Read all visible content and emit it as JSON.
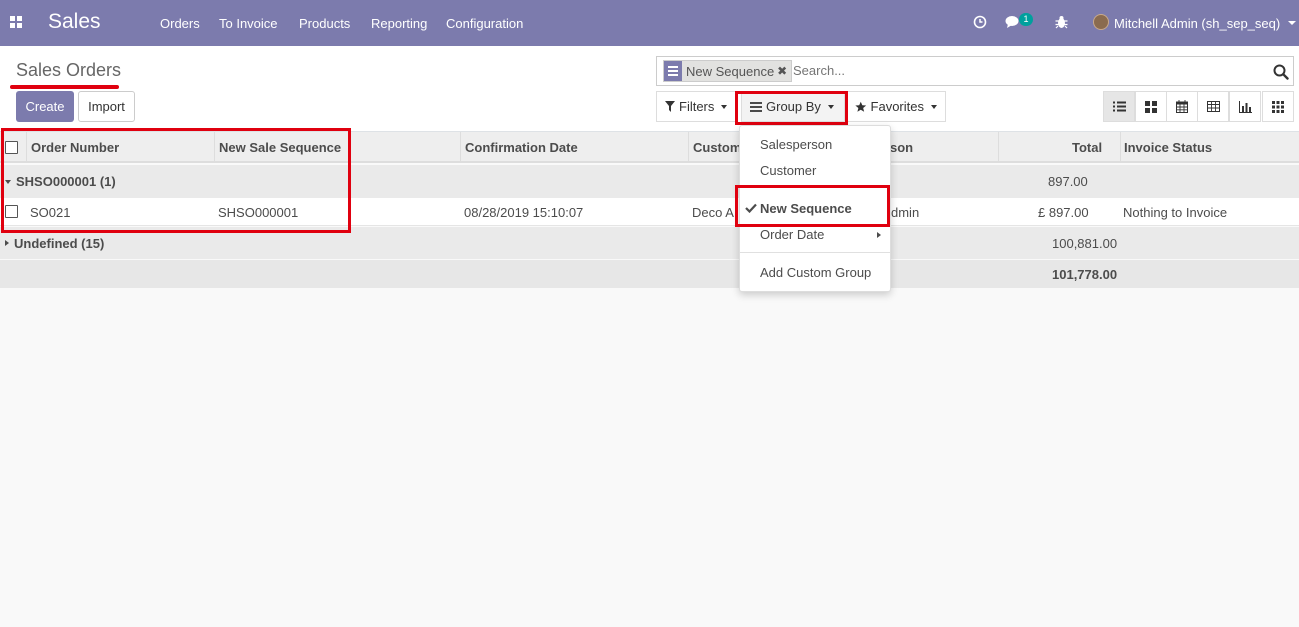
{
  "topbar": {
    "app_name": "Sales",
    "menu": [
      "Orders",
      "To Invoice",
      "Products",
      "Reporting",
      "Configuration"
    ],
    "message_count": "1",
    "user": "Mitchell Admin (sh_sep_seq)",
    "icons": [
      "apps-grid-icon",
      "clock-icon",
      "chat-icon",
      "bug-icon"
    ],
    "color": "#7c7bad"
  },
  "page": {
    "title": "Sales Orders",
    "create_label": "Create",
    "import_label": "Import"
  },
  "search": {
    "facet_label": "New Sequence",
    "facet_close": "✖",
    "placeholder": "Search..."
  },
  "search_buttons": {
    "filters": "Filters",
    "group_by": "Group By",
    "favorites": "Favorites"
  },
  "views": [
    "list",
    "kanban",
    "calendar",
    "pivot",
    "graph",
    "dashboard"
  ],
  "table": {
    "headers": [
      "Order Number",
      "New Sale Sequence",
      "Confirmation Date",
      "Custom",
      "son",
      "Total",
      "Invoice Status"
    ],
    "groups": [
      {
        "label": "SHSO000001 (1)",
        "total": "897.00",
        "rows": [
          {
            "order": "SO021",
            "sequence": "SHSO000001",
            "date": "08/28/2019 15:10:07",
            "customer": "Deco A",
            "salesperson": "dmin",
            "total": "£ 897.00",
            "invoice_status": "Nothing to Invoice"
          }
        ]
      },
      {
        "label": "Undefined (15)",
        "total": "100,881.00"
      }
    ],
    "grand_total": "101,778.00"
  },
  "group_by_menu": {
    "items": [
      "Salesperson",
      "Customer",
      "New Sequence",
      "Order Date",
      "Add Custom Group"
    ],
    "selected": "New Sequence"
  },
  "highlight_color": "#e0000f"
}
